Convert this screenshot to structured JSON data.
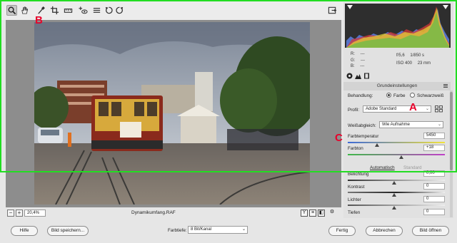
{
  "toolbar": {
    "tools": [
      {
        "name": "zoom-tool",
        "icon": "magnifier-icon",
        "active": true
      },
      {
        "name": "hand-tool",
        "icon": "hand-icon",
        "active": false
      },
      {
        "name": "white-balance-tool",
        "icon": "eyedropper-icon",
        "active": false
      },
      {
        "name": "crop-tool",
        "icon": "crop-icon",
        "active": false
      },
      {
        "name": "straighten-tool",
        "icon": "level-icon",
        "active": false
      },
      {
        "name": "red-eye-tool",
        "icon": "plus-eye-icon",
        "active": false
      },
      {
        "name": "preferences-tool",
        "icon": "list-icon",
        "active": false
      },
      {
        "name": "rotate-left-tool",
        "icon": "rotate-ccw-icon",
        "active": false
      },
      {
        "name": "rotate-right-tool",
        "icon": "rotate-cw-icon",
        "active": false
      }
    ],
    "export_icon": "export-icon"
  },
  "statusbar": {
    "zoom_minus": "−",
    "zoom_plus": "+",
    "zoom_value": "20,4%",
    "filename": "Dynamikumfang.RAF",
    "view_buttons": [
      "Y",
      "≡",
      "◧",
      "⚙"
    ]
  },
  "readout": {
    "r_label": "R:",
    "r_value": "---",
    "g_label": "G:",
    "g_value": "---",
    "b_label": "B:",
    "b_value": "---",
    "aperture": "f/5,6",
    "shutter": "1/850 s",
    "iso": "ISO 400",
    "focal": "23 mm"
  },
  "panel": {
    "section_title": "Grundeinstellungen",
    "treatment_label": "Behandlung:",
    "treatment_color": "Farbe",
    "treatment_bw": "Schwarzweiß",
    "profile_label": "Profil:",
    "profile_value": "Adobe Standard",
    "wb_label": "Weißabgleich:",
    "wb_value": "Wie Aufnahme",
    "temp_label": "Farbtemperatur",
    "temp_value": "5450",
    "temp_level": 0.3,
    "tint_label": "Farbton",
    "tint_value": "+18",
    "tint_level": 0.55,
    "auto_label": "Automatisch",
    "standard_label": "Standard",
    "exposure_label": "Belichtung",
    "exposure_value": "0,00",
    "contrast_label": "Kontrast",
    "contrast_value": "0",
    "highlights_label": "Lichter",
    "highlights_value": "0",
    "shadows_label": "Tiefen",
    "shadows_value": "0"
  },
  "bottom": {
    "help": "Hilfe",
    "save": "Bild speichern...",
    "depth_label": "Farbtiefe:",
    "depth_value": "8 Bit/Kanal",
    "done": "Fertig",
    "cancel": "Abbrechen",
    "open": "Bild öffnen"
  },
  "annotations": {
    "a": "A",
    "b": "B",
    "c": "C",
    "color": "#e8002a",
    "frame_color": "#22dd22"
  }
}
